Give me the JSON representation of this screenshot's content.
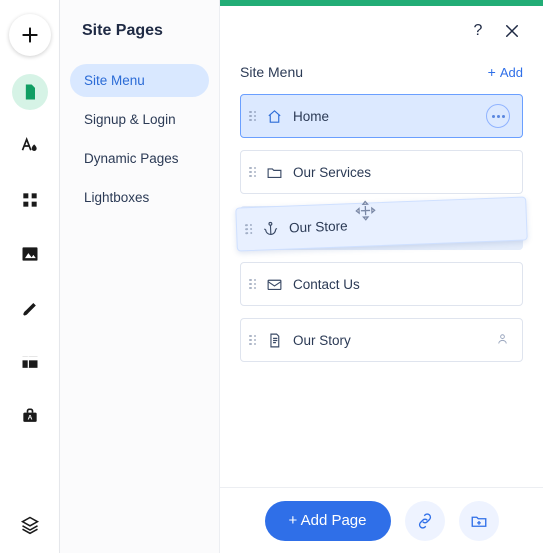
{
  "panel": {
    "title": "Site Pages"
  },
  "categories": [
    {
      "label": "Site Menu",
      "active": true
    },
    {
      "label": "Signup & Login",
      "active": false
    },
    {
      "label": "Dynamic Pages",
      "active": false
    },
    {
      "label": "Lightboxes",
      "active": false
    }
  ],
  "main": {
    "heading": "Site Menu",
    "add_link": "Add",
    "pages": [
      {
        "label": "Home",
        "icon": "home",
        "selected": true
      },
      {
        "label": "Our Services",
        "icon": "folder"
      },
      {
        "label": "Our Store",
        "icon": "anchor",
        "dragging": true
      },
      {
        "label": "Contact Us",
        "icon": "mail"
      },
      {
        "label": "Our Story",
        "icon": "page",
        "member": true
      }
    ]
  },
  "bottom": {
    "add_page": "+ Add Page"
  }
}
